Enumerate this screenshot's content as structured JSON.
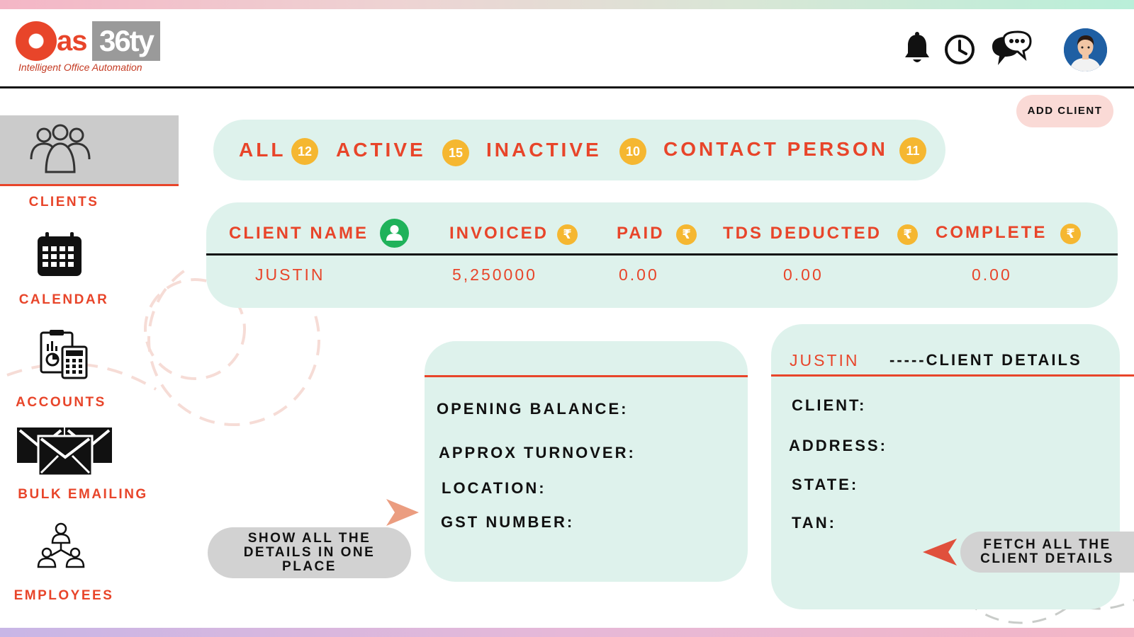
{
  "brand": {
    "logo_text": "Oas36ty",
    "tagline": "Intelligent Office Automation"
  },
  "header": {
    "icons": [
      "bell-icon",
      "clock-icon",
      "chat-icon"
    ],
    "avatar": "user-avatar"
  },
  "sidebar": {
    "items": [
      {
        "label": "CLIENTS",
        "icon": "clients-group-icon",
        "active": true
      },
      {
        "label": "CALENDAR",
        "icon": "calendar-icon",
        "active": false
      },
      {
        "label": "ACCOUNTS",
        "icon": "accounts-calculator-icon",
        "active": false
      },
      {
        "label": "BULK EMAILING",
        "icon": "envelopes-icon",
        "active": false
      },
      {
        "label": "EMPLOYEES",
        "icon": "employees-hierarchy-icon",
        "active": false
      }
    ]
  },
  "actions": {
    "add_client": "ADD CLIENT"
  },
  "tabs": [
    {
      "label": "ALL",
      "count": "12"
    },
    {
      "label": "ACTIVE",
      "count": "15"
    },
    {
      "label": "INACTIVE",
      "count": "10"
    },
    {
      "label": "CONTACT PERSON",
      "count": "11"
    }
  ],
  "table": {
    "headers": [
      "CLIENT NAME",
      "INVOICED",
      "PAID",
      "TDS DEDUCTED",
      "COMPLETE"
    ],
    "currency_symbol": "₹",
    "rows": [
      [
        "JUSTIN",
        "5,250000",
        "0.00",
        "0.00",
        "0.00"
      ]
    ]
  },
  "summary_card": {
    "fields": [
      "OPENING BALANCE:",
      "APPROX TURNOVER:",
      "LOCATION:",
      "GST NUMBER:"
    ]
  },
  "details_card": {
    "client_name": "JUSTIN",
    "title": "-----CLIENT DETAILS",
    "fields": [
      "CLIENT:",
      "ADDRESS:",
      "STATE:",
      "TAN:"
    ]
  },
  "callouts": {
    "left": "SHOW ALL THE DETAILS IN ONE PLACE",
    "right": "FETCH ALL THE CLIENT DETAILS"
  },
  "colors": {
    "accent": "#e8452a",
    "badge": "#f5b731",
    "panel": "#def2ec",
    "pill": "#d2d2d2"
  }
}
